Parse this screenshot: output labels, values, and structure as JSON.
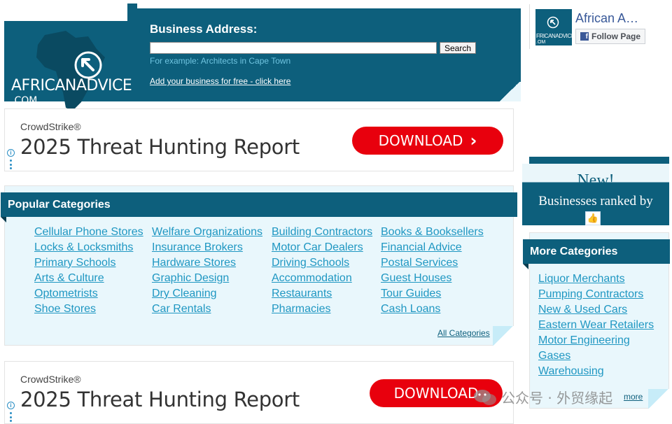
{
  "header": {
    "brand_name": "AFRICANADVICE",
    "brand_tld": ".COM",
    "address_label": "Business Address:",
    "address_value": "",
    "search_label": "Search",
    "example_text": "For example: Architects in Cape Town",
    "add_business_link": "Add your business for free - click here"
  },
  "facebook": {
    "page_name": "African A…",
    "follow_label": "Follow Page",
    "avatar_text": "FRICANADVICE",
    "avatar_sub": ".OM"
  },
  "ads": [
    {
      "brand": "CrowdStrike®",
      "title": "2025 Threat Hunting Report",
      "button": "DOWNLOAD",
      "chevron": "›"
    },
    {
      "brand": "CrowdStrike®",
      "title": "2025 Threat Hunting Report",
      "button": "DOWNLOAD"
    }
  ],
  "ad_info_glyph": "i",
  "popular": {
    "title": "Popular Categories",
    "columns": [
      [
        "Cellular Phone Stores",
        "Locks & Locksmiths",
        "Primary Schools",
        "Arts & Culture",
        "Optometrists",
        "Shoe Stores"
      ],
      [
        "Welfare Organizations",
        "Insurance Brokers",
        "Hardware Stores",
        "Graphic Design",
        "Dry Cleaning",
        "Car Rentals"
      ],
      [
        "Building Contractors",
        "Motor Car Dealers",
        "Driving Schools",
        "Accommodation",
        "Restaurants",
        "Pharmacies"
      ],
      [
        "Books & Booksellers",
        "Financial Advice",
        "Postal Services",
        "Guest Houses",
        "Tour Guides",
        "Cash Loans"
      ]
    ],
    "all_link": "All Categories"
  },
  "promo": {
    "title": "New!",
    "subtitle": "Businesses ranked by",
    "thumb_glyph": "👍"
  },
  "more": {
    "title": "More Categories",
    "items": [
      "Liquor Merchants",
      "Pumping Contractors",
      "New & Used Cars",
      "Eastern Wear Retailers",
      "Motor Engineering",
      "Gases",
      "Warehousing"
    ],
    "more_link": "more"
  },
  "watermark": "公众号 · 外贸缘起",
  "colors": {
    "brand_teal": "#0d5f7c",
    "link_blue": "#1f97c2",
    "ad_red": "#e8000d",
    "panel_bg": "#e9f7fc"
  }
}
